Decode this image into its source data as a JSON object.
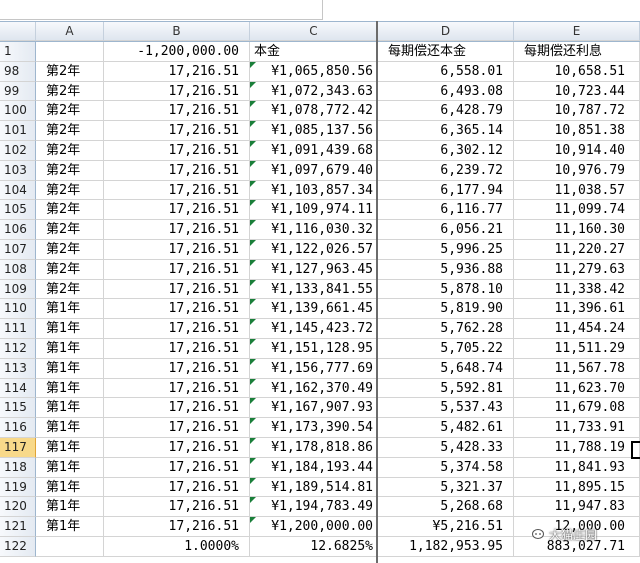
{
  "columns": {
    "rowhead": "",
    "A": "A",
    "B": "B",
    "C": "C",
    "D": "D",
    "E": "E"
  },
  "rows": [
    {
      "n": "1",
      "a": "",
      "b": "-1,200,000.00",
      "c": "本金",
      "d": "每期偿还本金",
      "e": "每期偿还利息",
      "header": true
    },
    {
      "n": "98",
      "a": "第2年",
      "b": "17,216.51",
      "c": "¥1,065,850.56",
      "d": "6,558.01",
      "e": "10,658.51"
    },
    {
      "n": "99",
      "a": "第2年",
      "b": "17,216.51",
      "c": "¥1,072,343.63",
      "d": "6,493.08",
      "e": "10,723.44"
    },
    {
      "n": "100",
      "a": "第2年",
      "b": "17,216.51",
      "c": "¥1,078,772.42",
      "d": "6,428.79",
      "e": "10,787.72"
    },
    {
      "n": "101",
      "a": "第2年",
      "b": "17,216.51",
      "c": "¥1,085,137.56",
      "d": "6,365.14",
      "e": "10,851.38"
    },
    {
      "n": "102",
      "a": "第2年",
      "b": "17,216.51",
      "c": "¥1,091,439.68",
      "d": "6,302.12",
      "e": "10,914.40"
    },
    {
      "n": "103",
      "a": "第2年",
      "b": "17,216.51",
      "c": "¥1,097,679.40",
      "d": "6,239.72",
      "e": "10,976.79"
    },
    {
      "n": "104",
      "a": "第2年",
      "b": "17,216.51",
      "c": "¥1,103,857.34",
      "d": "6,177.94",
      "e": "11,038.57"
    },
    {
      "n": "105",
      "a": "第2年",
      "b": "17,216.51",
      "c": "¥1,109,974.11",
      "d": "6,116.77",
      "e": "11,099.74"
    },
    {
      "n": "106",
      "a": "第2年",
      "b": "17,216.51",
      "c": "¥1,116,030.32",
      "d": "6,056.21",
      "e": "11,160.30"
    },
    {
      "n": "107",
      "a": "第2年",
      "b": "17,216.51",
      "c": "¥1,122,026.57",
      "d": "5,996.25",
      "e": "11,220.27"
    },
    {
      "n": "108",
      "a": "第2年",
      "b": "17,216.51",
      "c": "¥1,127,963.45",
      "d": "5,936.88",
      "e": "11,279.63"
    },
    {
      "n": "109",
      "a": "第2年",
      "b": "17,216.51",
      "c": "¥1,133,841.55",
      "d": "5,878.10",
      "e": "11,338.42"
    },
    {
      "n": "110",
      "a": "第1年",
      "b": "17,216.51",
      "c": "¥1,139,661.45",
      "d": "5,819.90",
      "e": "11,396.61"
    },
    {
      "n": "111",
      "a": "第1年",
      "b": "17,216.51",
      "c": "¥1,145,423.72",
      "d": "5,762.28",
      "e": "11,454.24"
    },
    {
      "n": "112",
      "a": "第1年",
      "b": "17,216.51",
      "c": "¥1,151,128.95",
      "d": "5,705.22",
      "e": "11,511.29"
    },
    {
      "n": "113",
      "a": "第1年",
      "b": "17,216.51",
      "c": "¥1,156,777.69",
      "d": "5,648.74",
      "e": "11,567.78"
    },
    {
      "n": "114",
      "a": "第1年",
      "b": "17,216.51",
      "c": "¥1,162,370.49",
      "d": "5,592.81",
      "e": "11,623.70"
    },
    {
      "n": "115",
      "a": "第1年",
      "b": "17,216.51",
      "c": "¥1,167,907.93",
      "d": "5,537.43",
      "e": "11,679.08"
    },
    {
      "n": "116",
      "a": "第1年",
      "b": "17,216.51",
      "c": "¥1,173,390.54",
      "d": "5,482.61",
      "e": "11,733.91"
    },
    {
      "n": "117",
      "a": "第1年",
      "b": "17,216.51",
      "c": "¥1,178,818.86",
      "d": "5,428.33",
      "e": "11,788.19",
      "selected": true
    },
    {
      "n": "118",
      "a": "第1年",
      "b": "17,216.51",
      "c": "¥1,184,193.44",
      "d": "5,374.58",
      "e": "11,841.93"
    },
    {
      "n": "119",
      "a": "第1年",
      "b": "17,216.51",
      "c": "¥1,189,514.81",
      "d": "5,321.37",
      "e": "11,895.15"
    },
    {
      "n": "120",
      "a": "第1年",
      "b": "17,216.51",
      "c": "¥1,194,783.49",
      "d": "5,268.68",
      "e": "11,947.83"
    },
    {
      "n": "121",
      "a": "第1年",
      "b": "17,216.51",
      "c": "¥1,200,000.00",
      "d": "¥5,216.51",
      "e": "12,000.00"
    },
    {
      "n": "122",
      "a": "",
      "b": "1.0000%",
      "c": "12.6825%",
      "d": "1,182,953.95",
      "e": "883,027.71"
    }
  ],
  "watermark": "大猫庄园"
}
